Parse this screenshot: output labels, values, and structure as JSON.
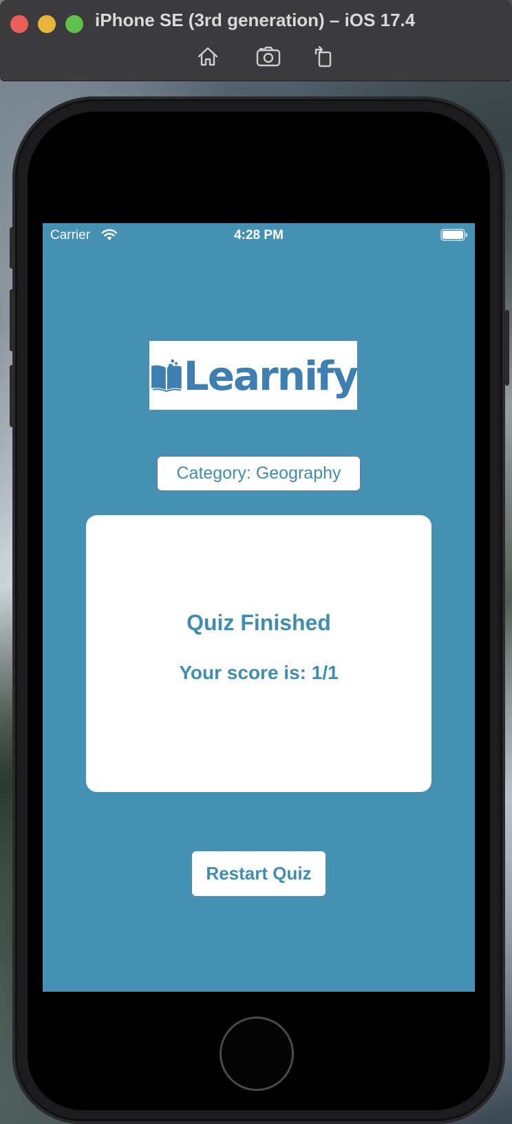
{
  "window": {
    "title": "iPhone SE (3rd generation) – iOS 17.4",
    "toolbar": {
      "home_icon": "home-icon",
      "screenshot_icon": "camera-icon",
      "rotate_icon": "rotate-icon"
    }
  },
  "status_bar": {
    "carrier": "Carrier",
    "time": "4:28 PM",
    "wifi_icon": "wifi-icon",
    "battery_icon": "battery-icon"
  },
  "app": {
    "logo_text": "Learnify",
    "category_label": "Category: Geography",
    "result": {
      "title": "Quiz Finished",
      "score": "Your score is: 1/1"
    },
    "restart_label": "Restart Quiz"
  },
  "colors": {
    "background": "#4591b3",
    "accent_text": "#3f8db1",
    "logo_blue": "#3c7fb0",
    "card": "#ffffff"
  }
}
